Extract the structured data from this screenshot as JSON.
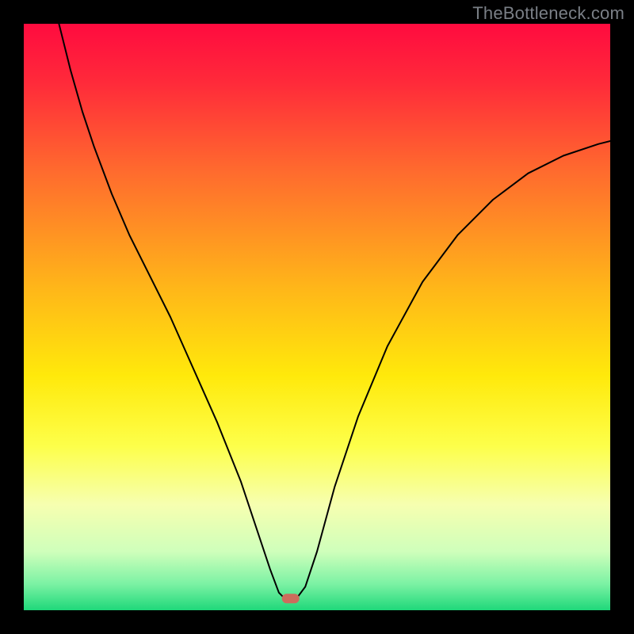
{
  "watermark": "TheBottleneck.com",
  "chart_data": {
    "type": "line",
    "title": "",
    "xlabel": "",
    "ylabel": "",
    "xlim": [
      0,
      100
    ],
    "ylim": [
      0,
      100
    ],
    "grid": false,
    "background": {
      "type": "vertical-gradient",
      "stops": [
        {
          "offset": 0.0,
          "color": "#ff0b3f"
        },
        {
          "offset": 0.1,
          "color": "#ff2a3a"
        },
        {
          "offset": 0.25,
          "color": "#ff6a2e"
        },
        {
          "offset": 0.45,
          "color": "#ffb619"
        },
        {
          "offset": 0.6,
          "color": "#ffe90b"
        },
        {
          "offset": 0.72,
          "color": "#fdff4a"
        },
        {
          "offset": 0.82,
          "color": "#f6ffb0"
        },
        {
          "offset": 0.9,
          "color": "#cfffbb"
        },
        {
          "offset": 0.955,
          "color": "#7cf2a4"
        },
        {
          "offset": 1.0,
          "color": "#1fd87a"
        }
      ]
    },
    "marker": {
      "x": 45.5,
      "y": 2.0,
      "color": "#cc6c5c",
      "shape": "rounded-rect"
    },
    "series": [
      {
        "name": "curve",
        "color": "#000000",
        "stroke_width": 2,
        "x": [
          6,
          8,
          10,
          12,
          15,
          18,
          21,
          25,
          29,
          33,
          37,
          40,
          42,
          43.5,
          44.5,
          46.5,
          48,
          50,
          53,
          57,
          62,
          68,
          74,
          80,
          86,
          92,
          98,
          100
        ],
        "y": [
          100,
          92,
          85,
          79,
          71,
          64,
          58,
          50,
          41,
          32,
          22,
          13,
          7,
          3,
          2,
          2,
          4,
          10,
          21,
          33,
          45,
          56,
          64,
          70,
          74.5,
          77.5,
          79.5,
          80
        ]
      }
    ]
  }
}
